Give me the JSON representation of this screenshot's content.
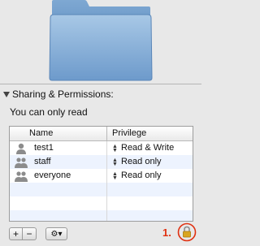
{
  "section": {
    "title": "Sharing & Permissions:"
  },
  "info": {
    "text": "You can only read"
  },
  "table": {
    "headers": {
      "name": "Name",
      "privilege": "Privilege"
    },
    "rows": [
      {
        "name": "test1",
        "privilege": "Read & Write",
        "icon": "single-user-icon"
      },
      {
        "name": "staff",
        "privilege": "Read only",
        "icon": "group-icon"
      },
      {
        "name": "everyone",
        "privilege": "Read only",
        "icon": "group-icon"
      }
    ]
  },
  "buttons": {
    "add": "+",
    "remove": "−",
    "action_menu": "⚙▾"
  },
  "annotation": {
    "label": "1."
  },
  "colors": {
    "folder": "#7fa9d1",
    "annotation": "#e03010",
    "lock": "#d9a520"
  }
}
